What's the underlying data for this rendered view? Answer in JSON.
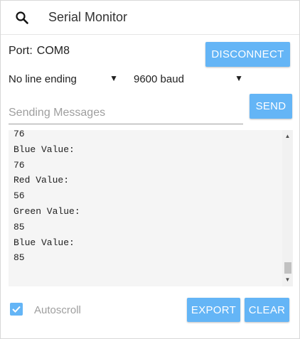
{
  "header": {
    "title": "Serial Monitor"
  },
  "port": {
    "label": "Port:",
    "value": "COM8"
  },
  "buttons": {
    "disconnect": "DISCONNECT",
    "send": "SEND",
    "export": "EXPORT",
    "clear": "CLEAR"
  },
  "selects": {
    "line_ending": "No line ending",
    "baud": "9600 baud",
    "caret": "▼"
  },
  "input": {
    "placeholder": "Sending Messages",
    "value": ""
  },
  "log": {
    "lines": [
      "76",
      "Blue Value:",
      "76",
      "Red Value:",
      "56",
      "Green Value:",
      "85",
      "Blue Value:",
      "85"
    ]
  },
  "scrollbar": {
    "up": "▲",
    "down": "▼"
  },
  "footer": {
    "autoscroll_label": "Autoscroll",
    "autoscroll_checked": true
  },
  "colors": {
    "accent": "#64b5f6",
    "log_background": "#f5f5f5",
    "muted_text": "#9e9e9e"
  },
  "icons": {
    "search": "search-icon",
    "checkbox": "check-icon"
  }
}
